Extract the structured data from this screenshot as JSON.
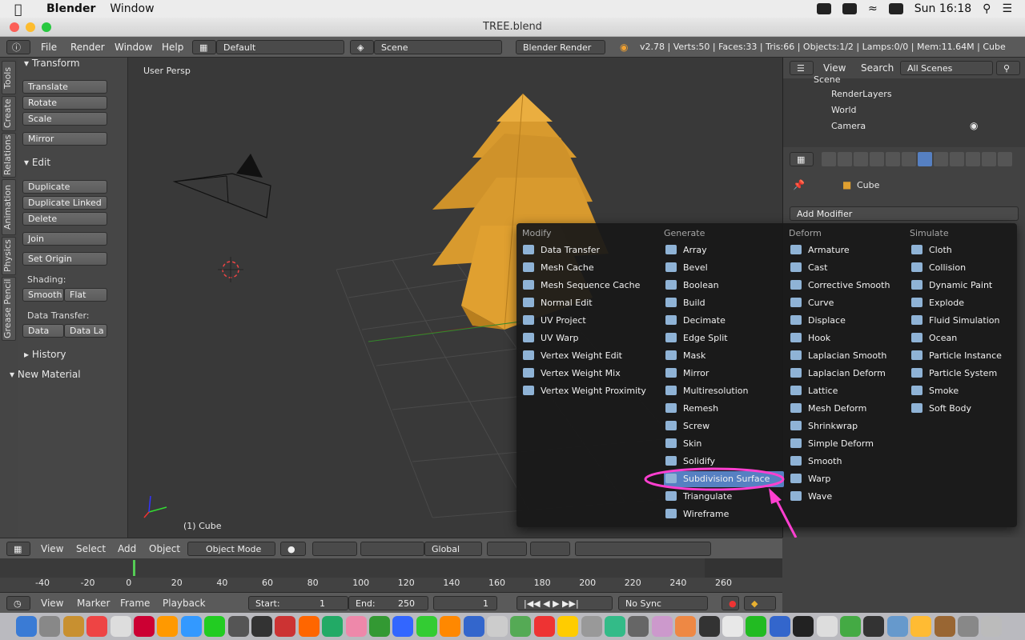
{
  "mac_menubar": {
    "app_name": "Blender",
    "menu_window": "Window",
    "clock": "Sun 16:18"
  },
  "window": {
    "title": "TREE.blend"
  },
  "header": {
    "menus": [
      "File",
      "Render",
      "Window",
      "Help"
    ],
    "layout": "Default",
    "scene": "Scene",
    "engine": "Blender Render",
    "stats": "v2.78 | Verts:50 | Faces:33 | Tris:66 | Objects:1/2 | Lamps:0/0 | Mem:11.64M | Cube"
  },
  "side_tabs": [
    "Tools",
    "Create",
    "Relations",
    "Animation",
    "Physics",
    "Grease Pencil"
  ],
  "tools": {
    "transform_header": "Transform",
    "translate": "Translate",
    "rotate": "Rotate",
    "scale": "Scale",
    "mirror": "Mirror",
    "edit_header": "Edit",
    "duplicate": "Duplicate",
    "duplicate_linked": "Duplicate Linked",
    "delete": "Delete",
    "join": "Join",
    "set_origin": "Set Origin",
    "shading_label": "Shading:",
    "smooth": "Smooth",
    "flat": "Flat",
    "data_transfer_label": "Data Transfer:",
    "data": "Data",
    "data_la": "Data La",
    "history_header": "History",
    "new_material_header": "New Material"
  },
  "viewport": {
    "persp_label": "User Persp",
    "object_label": "(1) Cube"
  },
  "outliner": {
    "view": "View",
    "search": "Search",
    "scope": "All Scenes",
    "items": [
      "Scene",
      "RenderLayers",
      "World",
      "Camera"
    ]
  },
  "properties": {
    "breadcrumb": "Cube",
    "add_modifier": "Add Modifier"
  },
  "modifier_menu": {
    "modify": {
      "header": "Modify",
      "items": [
        "Data Transfer",
        "Mesh Cache",
        "Mesh Sequence Cache",
        "Normal Edit",
        "UV Project",
        "UV Warp",
        "Vertex Weight Edit",
        "Vertex Weight Mix",
        "Vertex Weight Proximity"
      ]
    },
    "generate": {
      "header": "Generate",
      "items": [
        "Array",
        "Bevel",
        "Boolean",
        "Build",
        "Decimate",
        "Edge Split",
        "Mask",
        "Mirror",
        "Multiresolution",
        "Remesh",
        "Screw",
        "Skin",
        "Solidify",
        "Subdivision Surface",
        "Triangulate",
        "Wireframe"
      ]
    },
    "deform": {
      "header": "Deform",
      "items": [
        "Armature",
        "Cast",
        "Corrective Smooth",
        "Curve",
        "Displace",
        "Hook",
        "Laplacian Smooth",
        "Laplacian Deform",
        "Lattice",
        "Mesh Deform",
        "Shrinkwrap",
        "Simple Deform",
        "Smooth",
        "Warp",
        "Wave"
      ]
    },
    "simulate": {
      "header": "Simulate",
      "items": [
        "Cloth",
        "Collision",
        "Dynamic Paint",
        "Explode",
        "Fluid Simulation",
        "Ocean",
        "Particle Instance",
        "Particle System",
        "Smoke",
        "Soft Body"
      ]
    },
    "highlighted": "Subdivision Surface"
  },
  "view_header": {
    "menus": [
      "View",
      "Select",
      "Add",
      "Object"
    ],
    "mode": "Object Mode",
    "orientation": "Global"
  },
  "timeline": {
    "ticks": [
      "-40",
      "-20",
      "0",
      "20",
      "40",
      "60",
      "80",
      "100",
      "120",
      "140",
      "160",
      "180",
      "200",
      "220",
      "240",
      "260"
    ]
  },
  "timeline_header": {
    "menus": [
      "View",
      "Marker",
      "Frame",
      "Playback"
    ],
    "start_label": "Start:",
    "start": "1",
    "end_label": "End:",
    "end": "250",
    "current": "1",
    "sync": "No Sync"
  },
  "colors": {
    "accent": "#5680c2",
    "annotation": "#ff3fd0",
    "tree": "#e0a030"
  }
}
